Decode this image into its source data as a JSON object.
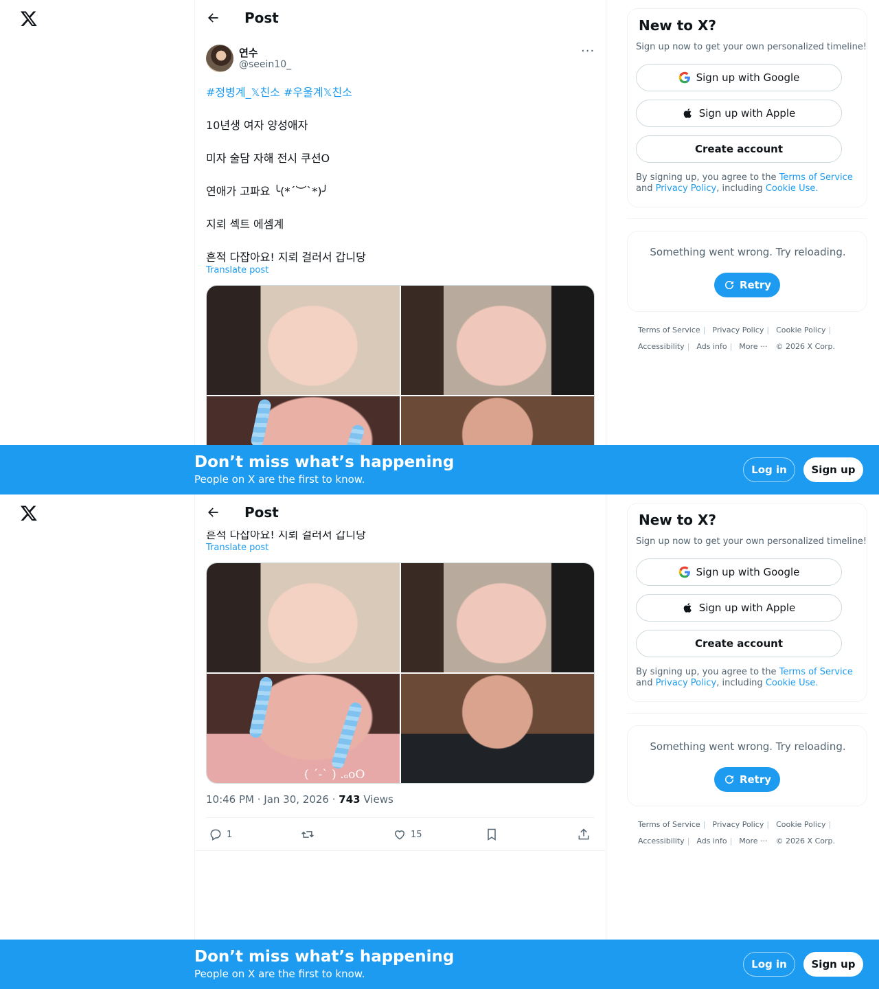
{
  "header": {
    "title": "Post"
  },
  "post": {
    "display_name": "연수",
    "handle": "@seein10_",
    "more": "···",
    "hashtags": "#정병계_𝕏친소 #우울계𝕏친소",
    "lines": [
      "10년생 여자 양성애자",
      "미자 술담 자해 전시 쿠션O",
      "연애가 고파요 ╰(*´︶`*)╯",
      "지뢰 섹트 에셈계",
      "흔적 다잡아요! 지뢰 걸러서 갑니당"
    ],
    "translate": "Translate post",
    "image_caption": "( ˊ-ˋ ) .ₒoO",
    "time": "10:46 PM · Jan 30, 2026 · ",
    "views_count": "743",
    "views_label": " Views",
    "replies": "1",
    "likes": "15"
  },
  "sidebar": {
    "title": "New to X?",
    "subtitle": "Sign up now to get your own personalized timeline!",
    "google": "Sign up with Google",
    "apple": "Sign up with Apple",
    "create": "Create account",
    "legal_pre": "By signing up, you agree to the ",
    "tos": "Terms of Service",
    "and": " and ",
    "privacy": "Privacy Policy",
    "including": ", including ",
    "cookie": "Cookie Use.",
    "error": "Something went wrong. Try reloading.",
    "retry": "Retry"
  },
  "footer": {
    "terms": "Terms of Service",
    "privacy": "Privacy Policy",
    "cookie": "Cookie Policy",
    "accessibility": "Accessibility",
    "ads": "Ads info",
    "more": "More ···",
    "copyright": "© 2026 X Corp."
  },
  "banner": {
    "headline": "Don’t miss what’s happening",
    "sub": "People on X are the first to know.",
    "login": "Log in",
    "signup": "Sign up"
  },
  "colors": {
    "accent": "#1d9bf0",
    "text": "#0f1419",
    "muted": "#536471"
  }
}
